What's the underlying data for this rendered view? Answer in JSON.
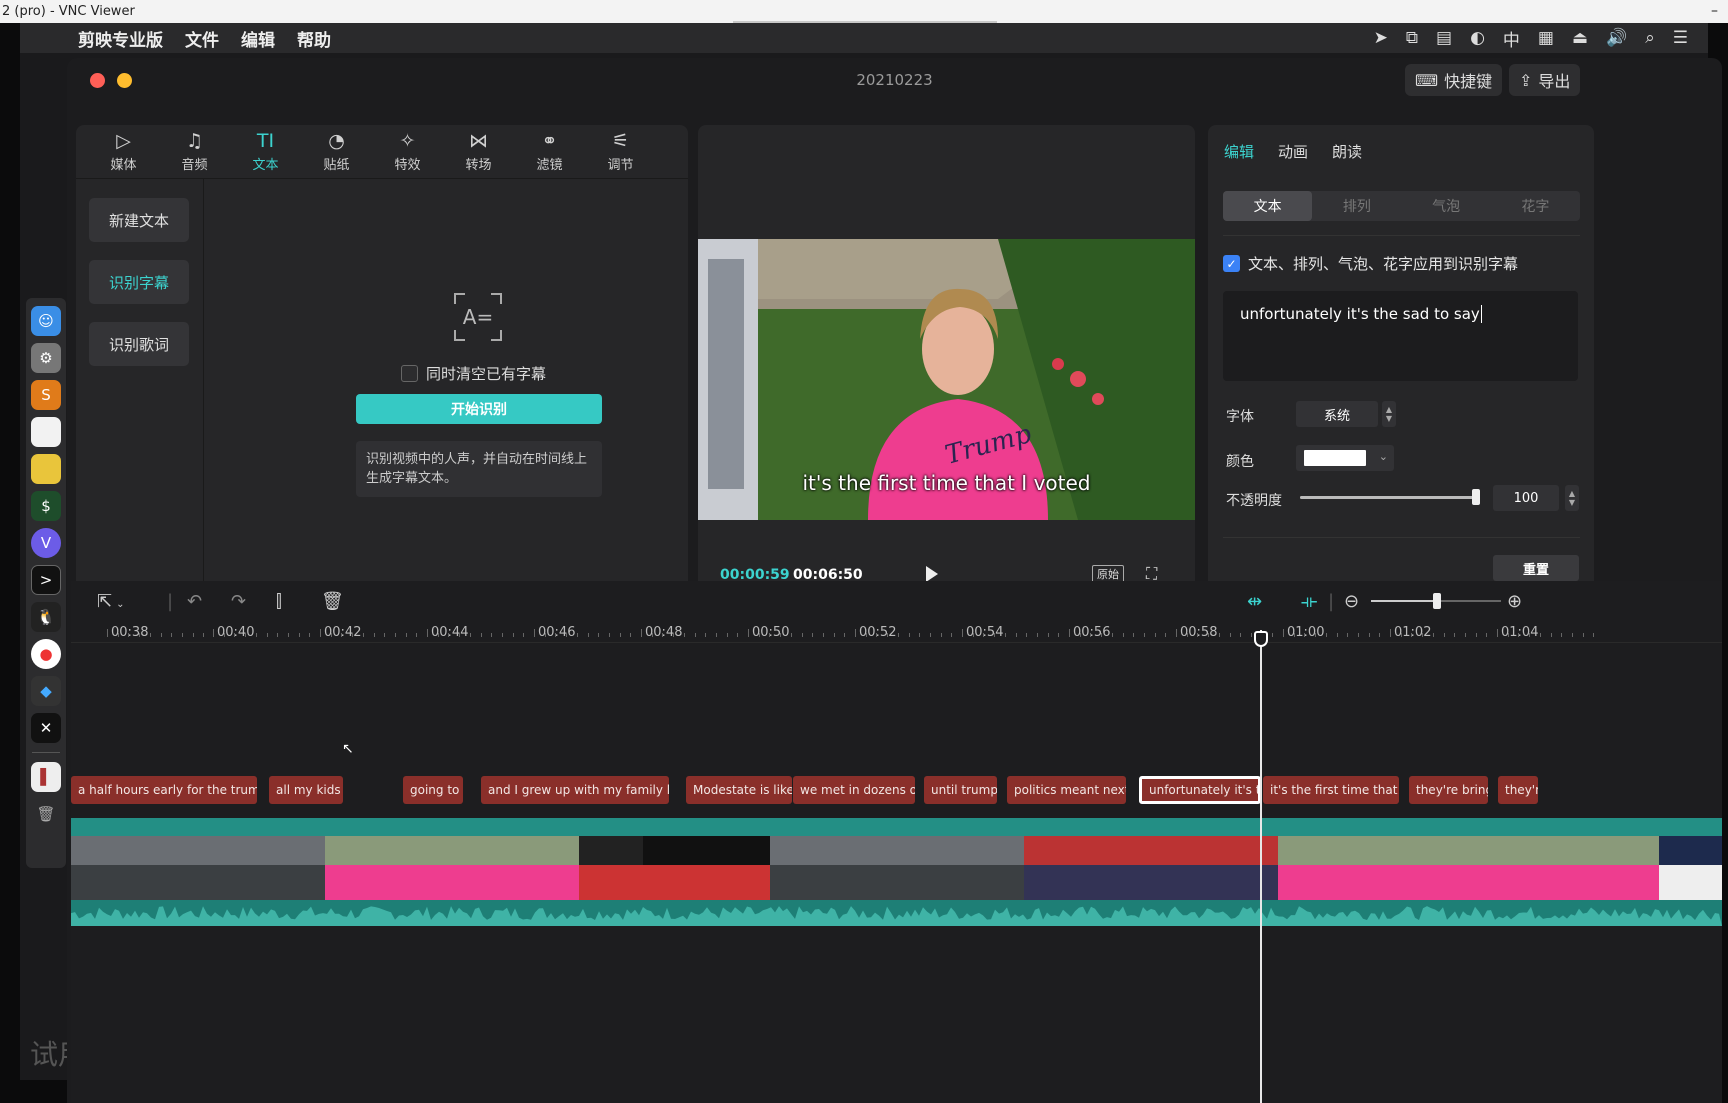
{
  "vnc": {
    "title": "2 (pro) - VNC Viewer",
    "minimize": "–"
  },
  "menubar": {
    "apple": "",
    "items": [
      "剪映专业版",
      "文件",
      "编辑",
      "帮助"
    ],
    "tray": [
      "➤",
      "⧉",
      "▤",
      "◐",
      "中",
      "▦",
      "⏏",
      "🔊",
      "⌕",
      "☰"
    ]
  },
  "window": {
    "title": "20210223",
    "shortcut_label": "快捷键",
    "export_label": "导出"
  },
  "toolbar": {
    "tools": [
      {
        "label": "媒体",
        "icon": "▷"
      },
      {
        "label": "音频",
        "icon": "♫"
      },
      {
        "label": "文本",
        "icon": "TI"
      },
      {
        "label": "贴纸",
        "icon": "◔"
      },
      {
        "label": "特效",
        "icon": "✧"
      },
      {
        "label": "转场",
        "icon": "⋈"
      },
      {
        "label": "滤镜",
        "icon": "⚭"
      },
      {
        "label": "调节",
        "icon": "⚟"
      }
    ]
  },
  "text_sidebar": {
    "items": [
      "新建文本",
      "识别字幕",
      "识别歌词"
    ]
  },
  "recognize": {
    "icon_text": "A=",
    "clear_existing_label": "同时清空已有字幕",
    "start_label": "开始识别",
    "tip": "识别视频中的人声，并自动在时间线上生成字幕文本。"
  },
  "player": {
    "subtitle": "it's the first time that I voted",
    "current_time": "00:00:59",
    "total_time": "00:06:50",
    "original_label": "原始"
  },
  "inspector": {
    "tabs": [
      "编辑",
      "动画",
      "朗读"
    ],
    "segments": [
      "文本",
      "排列",
      "气泡",
      "花字"
    ],
    "apply_label": "文本、排列、气泡、花字应用到识别字幕",
    "text_value": "unfortunately it's the sad to say",
    "font_label": "字体",
    "font_value": "系统",
    "color_label": "颜色",
    "color_value": "#ffffff",
    "opacity_label": "不透明度",
    "opacity_value": "100",
    "reset_label": "重置"
  },
  "timeline": {
    "ruler": [
      "00:38",
      "00:40",
      "00:42",
      "00:44",
      "00:46",
      "00:48",
      "00:50",
      "00:52",
      "00:54",
      "00:56",
      "00:58",
      "01:00",
      "01:02",
      "01:04"
    ],
    "subtitles": [
      "a half hours early for the trump rally",
      "all my kids a",
      "going to n",
      "and I grew up with my family loving",
      "Modestate is like n",
      "we met in dozens of i",
      "until trump c",
      "politics meant next to",
      "unfortunately it's th",
      "it's the first time that I vo",
      "they're bringi",
      "they'r"
    ],
    "playhead_time": "00:59"
  },
  "desktop": {
    "trial_text": "试用"
  },
  "colors": {
    "accent": "#3cd3cf",
    "subtitle_clip": "#8a2f2a",
    "main_track": "#238f85"
  }
}
